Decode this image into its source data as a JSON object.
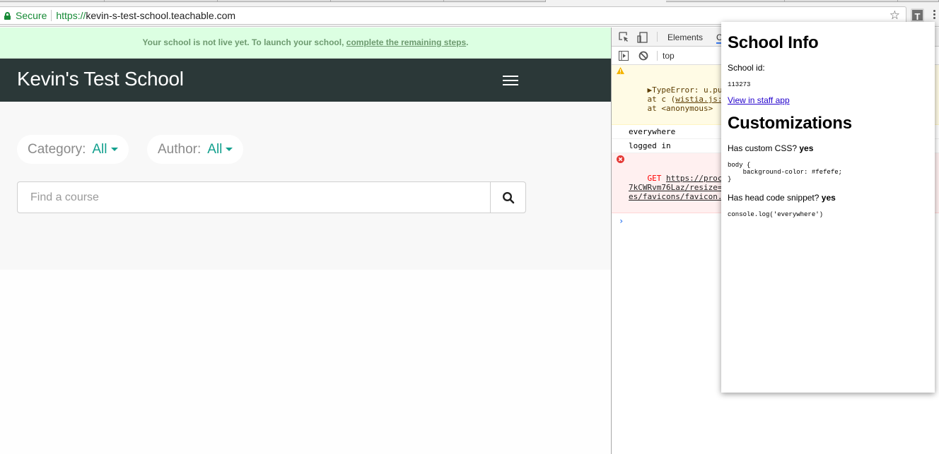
{
  "browser": {
    "secure_label": "Secure",
    "url_scheme": "https://",
    "url_host": "kevin-s-test-school.teachable.com",
    "bookmark_icon": "star-icon",
    "extension_label": "T",
    "menu_icon": "vertical-dots-icon"
  },
  "page": {
    "banner": {
      "text": "Your school is not live yet. To launch your school, ",
      "link": "complete the remaining steps",
      "suffix": "."
    },
    "navbar": {
      "brand": "Kevin's Test School",
      "menu_icon": "hamburger-icon"
    },
    "filters": [
      {
        "label": "Category:",
        "value": "All"
      },
      {
        "label": "Author:",
        "value": "All"
      }
    ],
    "search": {
      "placeholder": "Find a course",
      "value": "",
      "button_icon": "search-icon"
    }
  },
  "devtools": {
    "tabs": [
      {
        "label": "Elements",
        "active": false
      },
      {
        "label": "C",
        "active": true
      }
    ],
    "context": "top",
    "messages": [
      {
        "level": "warning",
        "lines": [
          "▶TypeError: u.push ",
          "    at c (",
          "wistia.js:",
          ")",
          "    at <anonymous>"
        ]
      },
      {
        "level": "log",
        "text": "everywhere"
      },
      {
        "level": "log",
        "text": "logged in"
      },
      {
        "level": "error",
        "method": "GET ",
        "lines": [
          "https://process.",
          "7kCWRvm76Laz/resize=",
          "es/favicons/favicon."
        ]
      }
    ],
    "prompt": "›"
  },
  "popup": {
    "title": "School Info",
    "school_id_label": "School id:",
    "school_id": "113273",
    "staff_link": "View in staff app",
    "customizations_title": "Customizations",
    "custom_css_label": "Has custom CSS? ",
    "custom_css_value": "yes",
    "custom_css_code": "body {\n    background-color: #fefefe;\n}",
    "head_code_label": "Has head code snippet? ",
    "head_code_value": "yes",
    "head_code": "console.log('everywhere')"
  }
}
